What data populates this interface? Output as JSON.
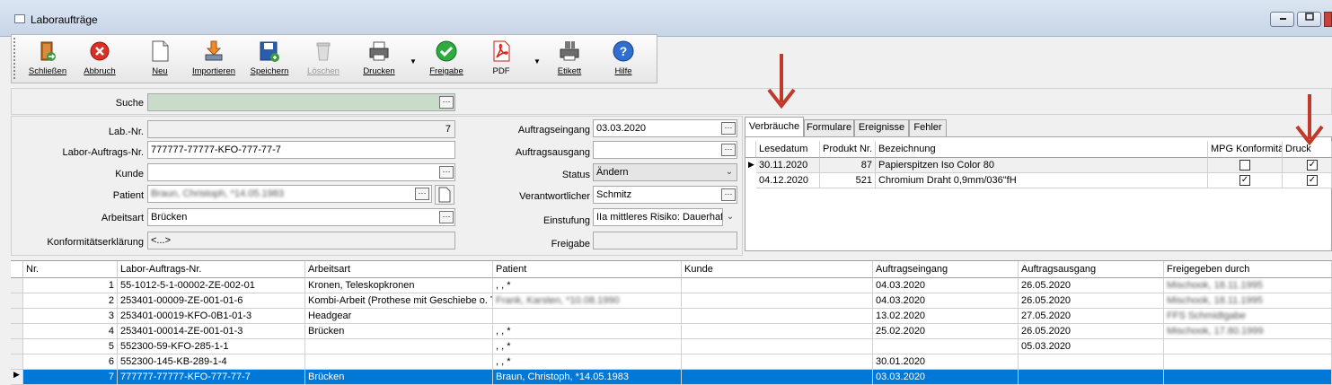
{
  "window": {
    "title": "Laboraufträge",
    "minimize": "▭",
    "maximize": "▭"
  },
  "toolbar": {
    "buttons": [
      {
        "label": "Schließen",
        "icon": "door-exit-icon"
      },
      {
        "label": "Abbruch",
        "icon": "cancel-x-icon"
      },
      {
        "label": "Neu",
        "icon": "new-document-icon"
      },
      {
        "label": "Importieren",
        "icon": "import-icon"
      },
      {
        "label": "Speichern",
        "icon": "save-disk-icon"
      },
      {
        "label": "Löschen",
        "icon": "trash-icon"
      },
      {
        "label": "Drucken",
        "icon": "printer-icon"
      },
      {
        "label": "Freigabe",
        "icon": "check-approve-icon"
      },
      {
        "label": "PDF",
        "icon": "pdf-icon"
      },
      {
        "label": "Etikett",
        "icon": "barcode-printer-icon"
      },
      {
        "label": "Hilfe",
        "icon": "help-icon"
      }
    ]
  },
  "search": {
    "label": "Suche",
    "value": ""
  },
  "form": {
    "lab_nr_label": "Lab.-Nr.",
    "lab_nr": "7",
    "auftrags_nr_label": "Labor-Auftrags-Nr.",
    "auftrags_nr": "777777-77777-KFO-777-77-7",
    "kunde_label": "Kunde",
    "kunde": "",
    "patient_label": "Patient",
    "patient": "Braun, Christoph, *14.05.1983",
    "arbeitsart_label": "Arbeitsart",
    "arbeitsart": "Brücken",
    "konformitaet_label": "Konformitätserklärung",
    "konformitaet": "<...>",
    "auftragseingang_label": "Auftragseingang",
    "auftragseingang": "03.03.2020",
    "auftragsausgang_label": "Auftragsausgang",
    "auftragsausgang": "",
    "status_label": "Status",
    "status": "Ändern",
    "verantwortlicher_label": "Verantwortlicher",
    "verantwortlicher": "Schmitz",
    "einstufung_label": "Einstufung",
    "einstufung": "IIa mittleres Risiko: Dauerhafte",
    "freigabe_label": "Freigabe",
    "freigabe": ""
  },
  "tabs": [
    "Verbräuche",
    "Formulare",
    "Ereignisse",
    "Fehler"
  ],
  "verbrauch_grid": {
    "headers": [
      "Lesedatum",
      "Produkt Nr.",
      "Bezeichnung",
      "MPG Konformität",
      "Druck"
    ],
    "rows": [
      {
        "datum": "30.11.2020",
        "produkt": "87",
        "bezeichnung": "Papierspitzen Iso Color 80",
        "mpg": "",
        "druck": "✓"
      },
      {
        "datum": "04.12.2020",
        "produkt": "521",
        "bezeichnung": "Chromium Draht 0,9mm/036\"fH",
        "mpg": "✓",
        "druck": "✓"
      }
    ]
  },
  "orders_grid": {
    "headers": [
      "Nr.",
      "Labor-Auftrags-Nr.",
      "Arbeitsart",
      "Patient",
      "Kunde",
      "Auftragseingang",
      "Auftragsausgang",
      "Freigegeben durch"
    ],
    "rows": [
      {
        "nr": "1",
        "auftrag": "55-1012-5-1-00002-ZE-002-01",
        "arbeitsart": "Kronen, Teleskopkronen",
        "patient": ", , *",
        "kunde": "",
        "eingang": "04.03.2020",
        "ausgang": "26.05.2020",
        "freigabe": "Mischook, 18.11.1995"
      },
      {
        "nr": "2",
        "auftrag": "253401-00009-ZE-001-01-6",
        "arbeitsart": "Kombi-Arbeit (Prothese mit Geschiebe o. Te",
        "patient": "Frank, Karsten, *10.08.1990",
        "kunde": "",
        "eingang": "04.03.2020",
        "ausgang": "26.05.2020",
        "freigabe": "Mischook, 18.11.1995"
      },
      {
        "nr": "3",
        "auftrag": "253401-00019-KFO-0B1-01-3",
        "arbeitsart": "Headgear",
        "patient": "",
        "kunde": "",
        "eingang": "13.02.2020",
        "ausgang": "27.05.2020",
        "freigabe": "FFS Schmidtgabe"
      },
      {
        "nr": "4",
        "auftrag": "253401-00014-ZE-001-01-3",
        "arbeitsart": "Brücken",
        "patient": ", , *",
        "kunde": "",
        "eingang": "25.02.2020",
        "ausgang": "26.05.2020",
        "freigabe": "Mischook, 17.80.1999"
      },
      {
        "nr": "5",
        "auftrag": "552300-59-KFO-285-1-1",
        "arbeitsart": "",
        "patient": ", , *",
        "kunde": "",
        "eingang": "",
        "ausgang": "05.03.2020",
        "freigabe": ""
      },
      {
        "nr": "6",
        "auftrag": "552300-145-KB-289-1-4",
        "arbeitsart": "",
        "patient": ", , *",
        "kunde": "",
        "eingang": "30.01.2020",
        "ausgang": "",
        "freigabe": ""
      },
      {
        "nr": "7",
        "auftrag": "777777-77777-KFO-777-77-7",
        "arbeitsart": "Brücken",
        "patient": "Braun, Christoph, *14.05.1983",
        "kunde": "",
        "eingang": "03.03.2020",
        "ausgang": "",
        "freigabe": ""
      }
    ]
  },
  "colors": {
    "arrow": "#c0392b",
    "selection": "#0078d7",
    "search_bg": "#c9dcc9"
  }
}
